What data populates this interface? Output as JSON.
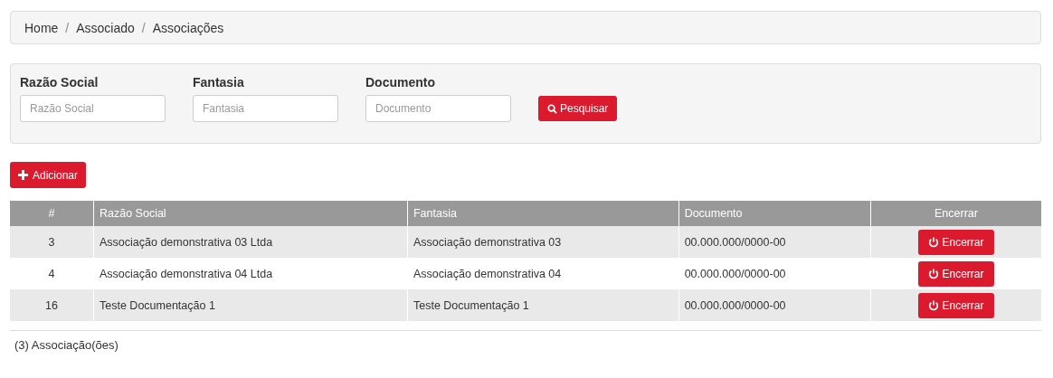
{
  "breadcrumb": [
    {
      "kind": "link",
      "text": "Home"
    },
    {
      "kind": "separator",
      "text": "/"
    },
    {
      "kind": "link",
      "text": "Associado"
    },
    {
      "kind": "separator",
      "text": "/"
    },
    {
      "kind": "current",
      "text": "Associações"
    }
  ],
  "filters": [
    {
      "label": "Razão Social",
      "placeholder": "Razão Social"
    },
    {
      "label": "Fantasia",
      "placeholder": "Fantasia"
    },
    {
      "label": "Documento",
      "placeholder": "Documento"
    }
  ],
  "search_button": "Pesquisar",
  "add_button": "Adicionar",
  "table": {
    "columns": [
      "#",
      "Razão Social",
      "Fantasia",
      "Documento",
      "Encerrar"
    ],
    "rows": [
      {
        "id": "3",
        "razao": "Associação demonstrativa 03 Ltda",
        "fantasia": "Associação demonstrativa 03",
        "documento": "00.000.000/0000-00",
        "action": "Encerrar"
      },
      {
        "id": "4",
        "razao": "Associação demonstrativa 04 Ltda",
        "fantasia": "Associação demonstrativa 04",
        "documento": "00.000.000/0000-00",
        "action": "Encerrar"
      },
      {
        "id": "16",
        "razao": "Teste Documentação 1",
        "fantasia": "Teste Documentação 1",
        "documento": "00.000.000/0000-00",
        "action": "Encerrar"
      }
    ]
  },
  "footer": "(3) Associação(ões)"
}
